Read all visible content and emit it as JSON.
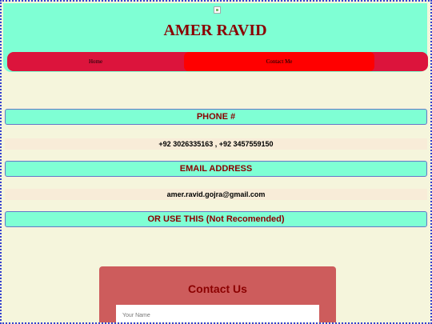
{
  "header": {
    "title": "AMER RAVID"
  },
  "nav": {
    "items": [
      {
        "label": "Home"
      },
      {
        "label": "Contact Me"
      }
    ],
    "active": "Contact Me"
  },
  "sections": {
    "phone": {
      "heading": "PHONE #",
      "value": "+92 3026335163 , +92 3457559150"
    },
    "email": {
      "heading": "EMAIL ADDRESS",
      "value": "amer.ravid.gojra@gmail.com"
    },
    "alternate": {
      "heading": "OR USE THIS (Not Recomended)"
    }
  },
  "contact_form": {
    "title": "Contact Us",
    "name_placeholder": "Your Name"
  },
  "colors": {
    "background": "#f5f5dc",
    "header_bg": "#7fffd4",
    "nav_bg": "#dc143c",
    "nav_active_bg": "#ff0000",
    "heading_text": "#8b0000",
    "card_bg": "#cd5c5c"
  },
  "icons": {
    "header_image": "broken-image-icon"
  }
}
